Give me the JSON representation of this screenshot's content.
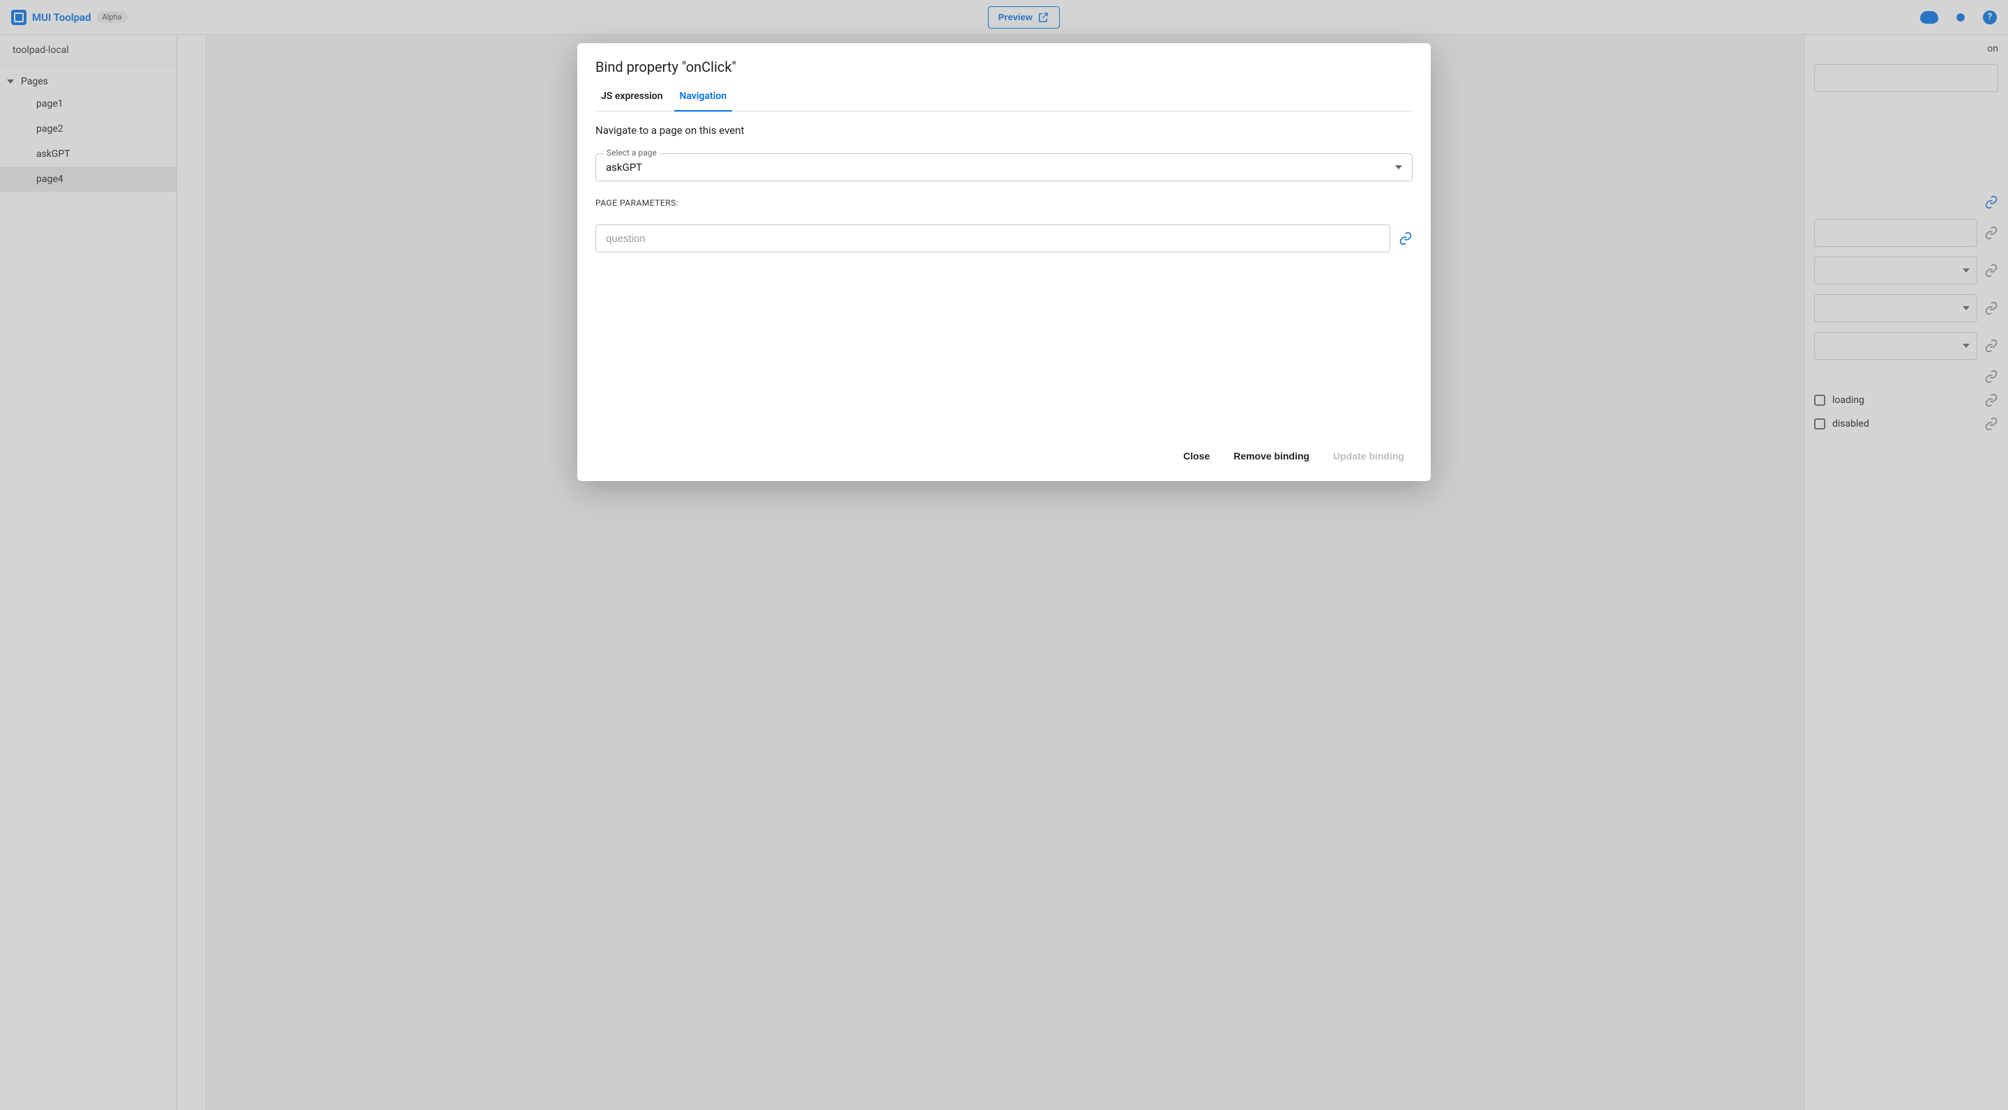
{
  "topbar": {
    "app_title": "MUI Toolpad",
    "badge": "Alpha",
    "preview_label": "Preview"
  },
  "sidebar": {
    "project_name": "toolpad-local",
    "pages_header": "Pages",
    "items": [
      {
        "label": "page1"
      },
      {
        "label": "page2"
      },
      {
        "label": "askGPT"
      },
      {
        "label": "page4"
      }
    ],
    "active_index": 3
  },
  "rightpanel": {
    "title_suffix": "on",
    "checkbox_loading": "loading",
    "checkbox_disabled": "disabled"
  },
  "modal": {
    "title": "Bind property \"onClick\"",
    "tabs": {
      "js": "JS expression",
      "nav": "Navigation"
    },
    "active_tab": "nav",
    "description": "Navigate to a page on this event",
    "select_label": "Select a page",
    "select_value": "askGPT",
    "params_label": "PAGE PARAMETERS:",
    "param_placeholder": "question",
    "footer": {
      "close": "Close",
      "remove": "Remove binding",
      "update": "Update binding"
    }
  }
}
